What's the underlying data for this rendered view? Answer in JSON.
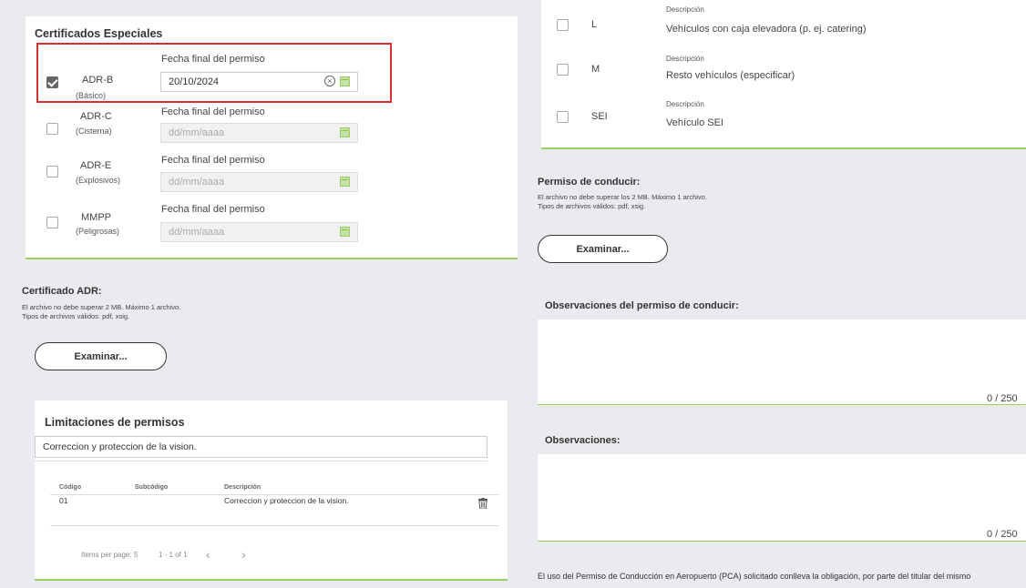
{
  "certificados": {
    "title": "Certificados Especiales",
    "date_label": "Fecha final del permiso",
    "date_placeholder": "dd/mm/aaaa",
    "items": [
      {
        "code": "ADR-B",
        "desc": "(Básico)",
        "checked": true,
        "value": "20/10/2024"
      },
      {
        "code": "ADR-C",
        "desc": "(Cisterna)",
        "checked": false,
        "value": ""
      },
      {
        "code": "ADR-E",
        "desc": "(Explosivos)",
        "checked": false,
        "value": ""
      },
      {
        "code": "MMPP",
        "desc": "(Peligrosas)",
        "checked": false,
        "value": ""
      }
    ]
  },
  "certificado_adr": {
    "title": "Certificado ADR:",
    "note1": "El archivo no debe superar 2 MB. Máximo 1 archivo.",
    "note2": "Tipos de archivos válidos: pdf, xsig.",
    "button": "Examinar..."
  },
  "limitaciones": {
    "title": "Limitaciones de permisos",
    "input_value": "Correccion y proteccion de la vision.",
    "columns": [
      "Código",
      "Subcódigo",
      "Descripción"
    ],
    "rows": [
      {
        "codigo": "01",
        "subcodigo": "",
        "descripcion": "Correccion y proteccion de la vision."
      }
    ],
    "items_per_page_label": "Items per page:",
    "items_per_page_value": "5",
    "range": "1 - 1 of 1",
    "prev": "‹",
    "next": "›"
  },
  "vehiculos": {
    "desc_label": "Descripción",
    "items": [
      {
        "code": "L",
        "desc": "Vehículos con caja elevadora (p. ej. catering)"
      },
      {
        "code": "M",
        "desc": "Resto vehículos (especificar)"
      },
      {
        "code": "SEI",
        "desc": "Vehículo SEI"
      }
    ]
  },
  "permiso_conducir": {
    "title": "Permiso de conducir:",
    "note1": "El archivo no debe superar los 2 MB. Máximo 1 archivo.",
    "note2": "Tipos de archivos válidos: pdf, xsig.",
    "button": "Examinar..."
  },
  "observaciones_permiso": {
    "title": "Observaciones del permiso de conducir:",
    "counter": "0 / 250"
  },
  "observaciones": {
    "title": "Observaciones:",
    "counter": "0 / 250"
  },
  "footer_text": "El uso del Permiso de Conducción en Aeropuerto (PCA) solicitado conlleva la obligación, por parte del titular del mismo"
}
